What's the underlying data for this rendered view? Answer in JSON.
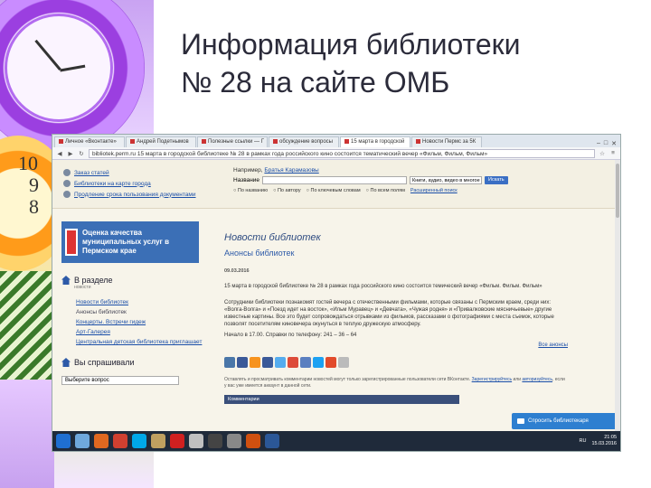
{
  "slide": {
    "title_line1": "Информация библиотеки",
    "title_line2": "№ 28 на сайте ОМБ"
  },
  "browser": {
    "tabs": [
      {
        "label": "Личное «Вконтакте»",
        "active": false
      },
      {
        "label": "Андрей Подетнымов",
        "active": false
      },
      {
        "label": "Полезные ссылки — Г",
        "active": false
      },
      {
        "label": "обсуждение вопросы",
        "active": false
      },
      {
        "label": "15 марта в городской",
        "active": true
      },
      {
        "label": "Новости Пермс за 5К",
        "active": false
      }
    ],
    "url": "bibliotek.perm.ru   15 марта в городской библиотеке № 28 в рамках года российского кино состоится тематический вечер «Фильм, Фильм, Фильм»"
  },
  "header": {
    "links": [
      "Заказ статей",
      "Библиотеки на карте города",
      "Продление срока пользования документами"
    ],
    "example_prefix": "Например, ",
    "example_link": "Братья Карамазовы",
    "search_label": "Название",
    "select_value": "Книги, аудио, видео в многое другое",
    "search_button": "Искать",
    "radios": [
      "По названию",
      "По автору",
      "По ключевым словам",
      "По всем полям"
    ],
    "advanced": "Расширенный поиск"
  },
  "left": {
    "banner": "Оценка качества муниципальных услуг в Пермском крае",
    "section_title": "В разделе",
    "section_sub": "новости",
    "links": [
      {
        "label": "Новости библиотек",
        "link": true
      },
      {
        "label": "Анонсы библиотек",
        "link": false
      },
      {
        "label": "Концерты. Встречи гидеж",
        "link": true
      },
      {
        "label": "Арт-Галерея",
        "link": true
      },
      {
        "label": "Центральная детская библиотека приглашает",
        "link": true
      }
    ],
    "ask_title": "Вы спрашивали",
    "ask_select": "Выберите вопрос"
  },
  "main": {
    "title": "Новости библиотек",
    "subtitle": "Анонсы библиотек",
    "date": "09.03.2016",
    "para1": "15 марта в городской библиотеке № 28 в рамках года российского кино состоится темический вечер «Фильм. Фильм. Фильм»",
    "para2": "Сотрудники библиотеки познакомят гостей вечера с отечественными фильмами, которые связаны с Пермским краем, среди них: «Волга-Волга» и «Поезд идет на восток», «Ильм Муравец» и «Девчата», «Чужая родня» и «Привалковские мясничьевые» другие известные картины. Все это будет сопровождаться отрывками из фильмов, рассказами о фотографиями с места съемок, которые позволят посетителям киновечера окунуться в теплую дружескую атмосферу.",
    "para3": "Начало в 17.00. Справки по телефону: 241 – 36 – 64",
    "all_link": "Все анонсы",
    "note_prefix": "Оставлять и просматривать комментарии новостей могут только зарегистрированные пользователи сети ВКонтакте. ",
    "note_link1": "Зарегистрируйтесь",
    "note_mid": " или ",
    "note_link2": "авторизуйтесь",
    "note_suffix": ", если у вас уже имеется аккаунт в данной сети.",
    "comments": "Комментарии",
    "ask_button": "Спросить библиотекаря",
    "social_colors": [
      "#4a76a8",
      "#3b5998",
      "#f7931e",
      "#3b5998",
      "#55acee",
      "#dd4b39",
      "#5b7fc0",
      "#1da1f2",
      "#e24b2b",
      "#bbbbbb"
    ]
  },
  "taskbar": {
    "lang": "RU",
    "time": "21:05",
    "date": "15.03.2016",
    "icon_colors": [
      "#1f6fd1",
      "#6fa8dc",
      "#e06820",
      "#d04030",
      "#00a8e8",
      "#c0a060",
      "#d02020",
      "#c0c0c0",
      "#444444",
      "#888888",
      "#d05010",
      "#2b5797"
    ]
  }
}
